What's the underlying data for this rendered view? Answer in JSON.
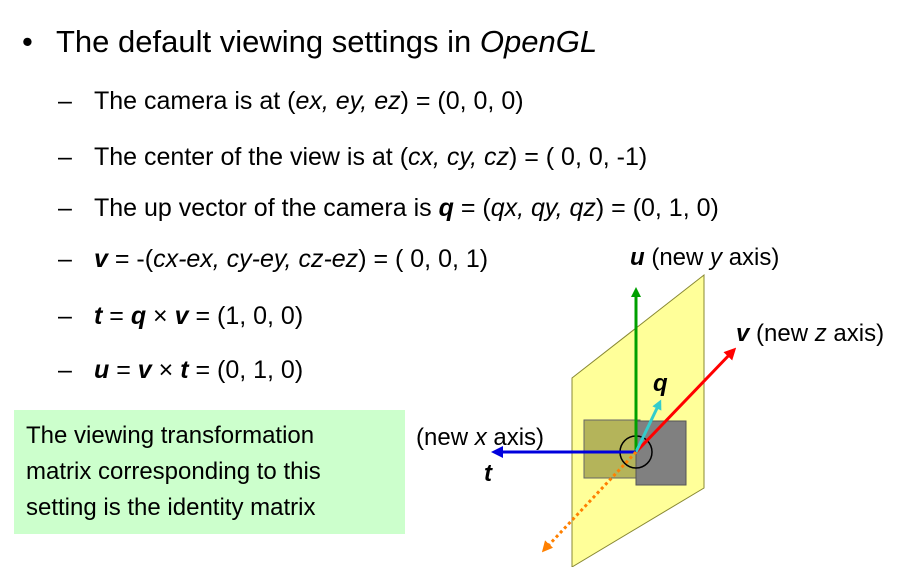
{
  "bullet": {
    "marker": "•",
    "text": "The default viewing settings in ",
    "text_em": "OpenGL"
  },
  "items": [
    {
      "dash": "–",
      "pre": "The camera is at (",
      "em": "ex, ey, ez",
      "post": ") = (0, 0, 0)"
    },
    {
      "dash": "–",
      "pre": "The center of the view is at (",
      "em": "cx, cy, cz",
      "post": ") = ( 0, 0, -1)"
    },
    {
      "dash": "–",
      "pre": "The up vector of the camera  is ",
      "bold": "q",
      "mid": " = (",
      "em": "qx, qy, qz",
      "post": ") = (0, 1, 0)"
    },
    {
      "dash": "–",
      "bold": "v",
      "mid": " = -(",
      "em": "cx-ex, cy-ey, cz-ez",
      "post": ") = ( 0, 0, 1)"
    },
    {
      "dash": "–",
      "a": "t",
      "eq": " = ",
      "b": "q",
      "op": " × ",
      "c": "v",
      "post": " = (1, 0, 0)"
    },
    {
      "dash": "–",
      "a": "u",
      "eq": " = ",
      "b": "v",
      "op": " × ",
      "c": "t",
      "post": " = (0, 1, 0)"
    }
  ],
  "callout": {
    "lines": [
      "The viewing transformation",
      "matrix corresponding to this",
      "setting is the identity matrix"
    ],
    "color": "#ccffcc"
  },
  "diagram": {
    "u_label": {
      "sym": "u",
      "pre": " (new ",
      "em": "y",
      "post": " axis)"
    },
    "v_label": {
      "sym": "v",
      "pre": " (new ",
      "em": "z",
      "post": " axis)"
    },
    "x_label": {
      "pre": "(new ",
      "em": "x",
      "post": " axis)"
    },
    "t_label": "t",
    "q_label": "q",
    "colors": {
      "plane": "#ffff99",
      "u_axis": "#00a000",
      "v_axis": "#ff0000",
      "t_axis": "#0000dd",
      "q_vector": "#33cccc",
      "view_dir": "#ff8000",
      "square_front": "#808080",
      "square_back": "#b4b45a"
    }
  }
}
